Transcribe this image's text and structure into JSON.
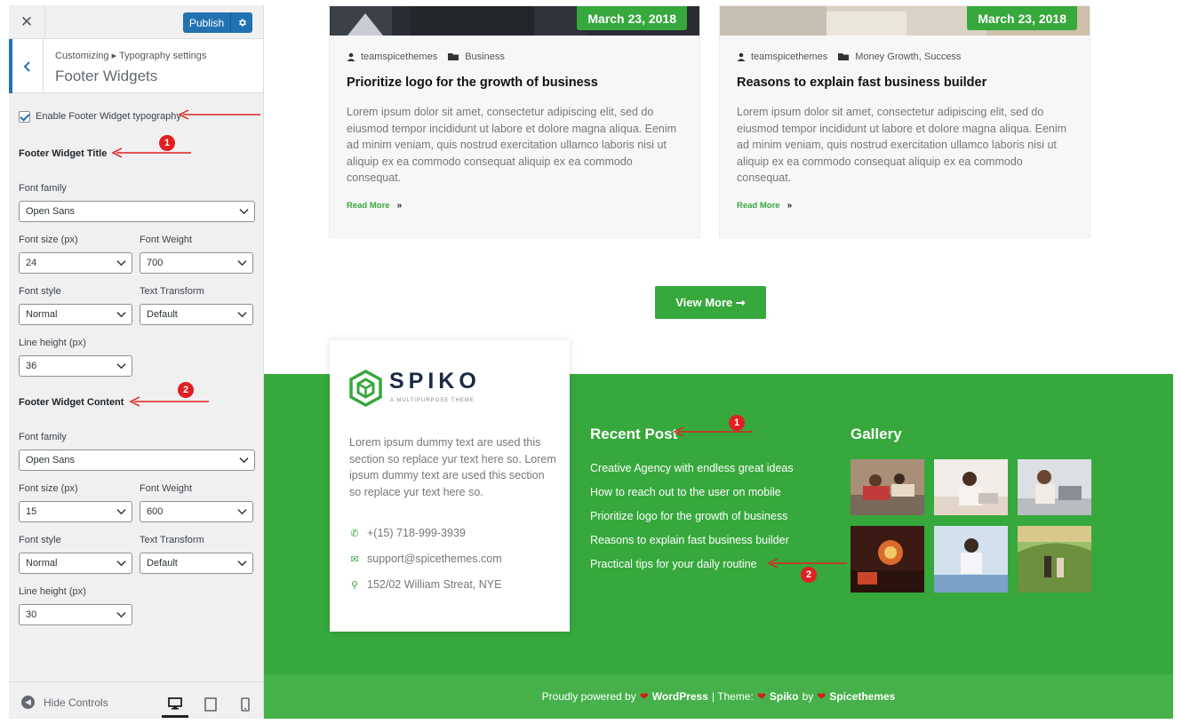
{
  "sidebar": {
    "close_label": "✕",
    "publish_label": "Publish",
    "breadcrumb": "Customizing ▸ Typography settings",
    "section_title": "Footer Widgets",
    "enable_label": "Enable Footer Widget typography",
    "title_group": {
      "heading": "Footer Widget Title",
      "font_family_label": "Font family",
      "font_family": "Open Sans",
      "font_size_label": "Font size (px)",
      "font_size": "24",
      "font_weight_label": "Font Weight",
      "font_weight": "700",
      "font_style_label": "Font style",
      "font_style": "Normal",
      "text_transform_label": "Text Transform",
      "text_transform": "Default",
      "line_height_label": "Line height (px)",
      "line_height": "36"
    },
    "content_group": {
      "heading": "Footer Widget Content",
      "font_family_label": "Font family",
      "font_family": "Open Sans",
      "font_size_label": "Font size (px)",
      "font_size": "15",
      "font_weight_label": "Font Weight",
      "font_weight": "600",
      "font_style_label": "Font style",
      "font_style": "Normal",
      "text_transform_label": "Text Transform",
      "text_transform": "Default",
      "line_height_label": "Line height (px)",
      "line_height": "30"
    },
    "hide_controls": "Hide Controls",
    "accent_color": "#2271b1"
  },
  "posts": [
    {
      "date": "March 23, 2018",
      "author": "teamspicethemes",
      "category": "Business",
      "title": "Prioritize logo for the growth of business",
      "excerpt": "Lorem ipsum dolor sit amet, consectetur adipiscing elit, sed do eiusmod tempor incididunt ut labore et dolore magna aliqua. Eenim ad minim veniam, quis nostrud exercitation ullamco laboris nisi ut aliquip ex ea commodo consequat aliquip ex ea commodo consequat.",
      "read_more": "Read More"
    },
    {
      "date": "March 23, 2018",
      "author": "teamspicethemes",
      "category": "Money Growth, Success",
      "title": "Reasons to explain fast business builder",
      "excerpt": "Lorem ipsum dolor sit amet, consectetur adipiscing elit, sed do eiusmod tempor incididunt ut labore et dolore magna aliqua. Eenim ad minim veniam, quis nostrud exercitation ullamco laboris nisi ut aliquip ex ea commodo consequat aliquip ex ea commodo consequat.",
      "read_more": "Read More"
    }
  ],
  "view_more": "View More ➞",
  "footer": {
    "logo_text": "SPIKO",
    "logo_tagline": "A MULTIPURPOSE THEME",
    "about": "Lorem ipsum dummy text are used this section so replace yur text here so. Lorem ipsum dummy text are used this section so replace yur text here so.",
    "phone": "+(15) 718-999-3939",
    "email": "support@spicethemes.com",
    "address": "152/02 William Streat, NYE",
    "recent_title": "Recent Post",
    "recent_posts": [
      "Creative Agency with endless great ideas",
      "How to reach out to the user on mobile",
      "Prioritize logo for the growth of business",
      "Reasons to explain fast business builder",
      "Practical tips for your daily routine"
    ],
    "gallery_title": "Gallery",
    "copyright": {
      "powered": "Proudly powered by",
      "wordpress": "WordPress",
      "theme_sep": "| Theme:",
      "theme": "Spiko",
      "by": "by",
      "author": "Spicethemes"
    },
    "brand_green": "#36a83c"
  },
  "badges": [
    "1",
    "2",
    "1",
    "2"
  ]
}
